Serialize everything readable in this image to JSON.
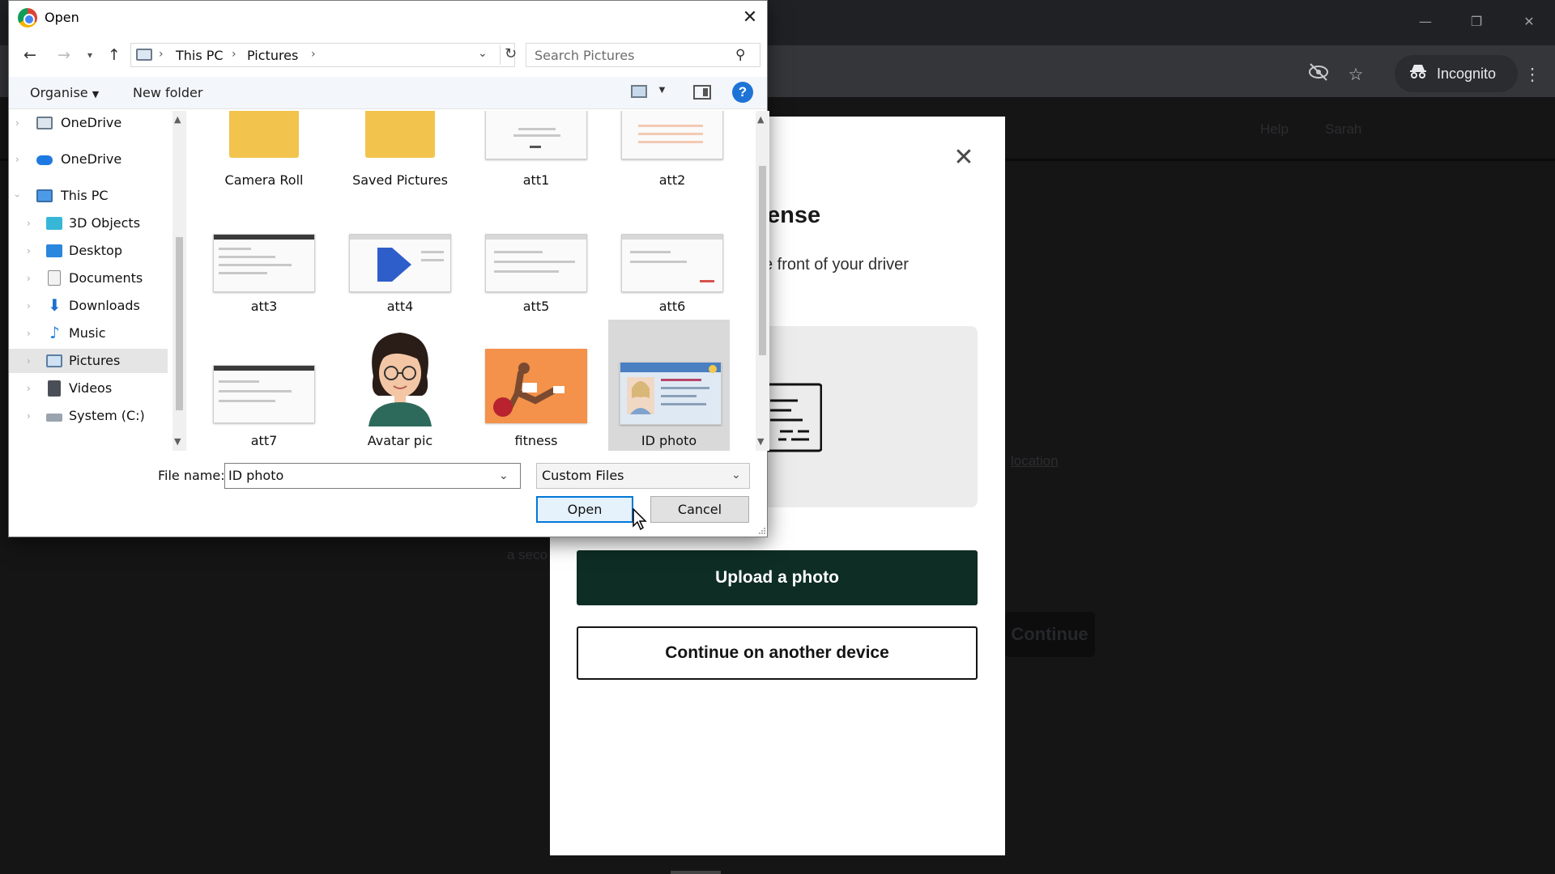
{
  "browser": {
    "incognito_label": "Incognito",
    "page_header_links": [
      "Help",
      "Sarah"
    ],
    "ghost_link": "location",
    "ghost_continue": "Continue",
    "ghost_note": "a seco"
  },
  "modal": {
    "title": "ense",
    "description": "e front of your driver",
    "upload_label": "Upload a photo",
    "continue_label": "Continue on another device"
  },
  "dialog": {
    "title": "Open",
    "breadcrumb": [
      "This PC",
      "Pictures"
    ],
    "search_placeholder": "Search Pictures",
    "organise_label": "Organise",
    "new_folder_label": "New folder",
    "nav_items": [
      {
        "label": "OneDrive",
        "icon": "onedrive-folder-icon"
      },
      {
        "label": "OneDrive",
        "icon": "onedrive-cloud-icon"
      },
      {
        "label": "This PC",
        "icon": "this-pc-icon"
      },
      {
        "label": "3D Objects",
        "icon": "3d-objects-icon"
      },
      {
        "label": "Desktop",
        "icon": "desktop-icon"
      },
      {
        "label": "Documents",
        "icon": "documents-icon"
      },
      {
        "label": "Downloads",
        "icon": "downloads-icon"
      },
      {
        "label": "Music",
        "icon": "music-icon"
      },
      {
        "label": "Pictures",
        "icon": "pictures-icon"
      },
      {
        "label": "Videos",
        "icon": "videos-icon"
      },
      {
        "label": "System (C:)",
        "icon": "drive-icon"
      }
    ],
    "files": [
      {
        "name": "Camera Roll",
        "kind": "folder"
      },
      {
        "name": "Saved Pictures",
        "kind": "folder"
      },
      {
        "name": "att1",
        "kind": "screenshot"
      },
      {
        "name": "att2",
        "kind": "screenshot"
      },
      {
        "name": "att3",
        "kind": "screenshot"
      },
      {
        "name": "att4",
        "kind": "screenshot"
      },
      {
        "name": "att5",
        "kind": "screenshot"
      },
      {
        "name": "att6",
        "kind": "screenshot"
      },
      {
        "name": "att7",
        "kind": "screenshot"
      },
      {
        "name": "Avatar pic",
        "kind": "image"
      },
      {
        "name": "fitness",
        "kind": "image"
      },
      {
        "name": "ID photo",
        "kind": "image",
        "selected": true
      }
    ],
    "file_name_label": "File name:",
    "file_name_value": "ID photo",
    "file_type_value": "Custom Files",
    "open_label": "Open",
    "cancel_label": "Cancel"
  },
  "colors": {
    "upload_button": "#0e2d24",
    "dialog_accent": "#0078d7",
    "selection": "#d9d9d9"
  }
}
